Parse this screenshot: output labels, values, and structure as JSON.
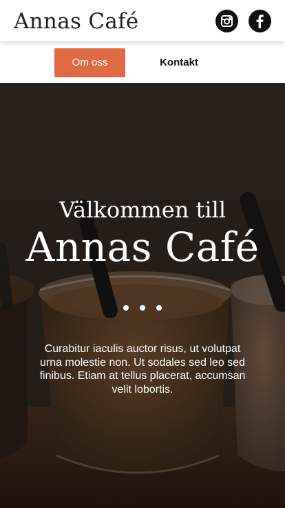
{
  "header": {
    "brand": "Annas Café",
    "social": [
      {
        "icon": "instagram-icon"
      },
      {
        "icon": "facebook-icon"
      }
    ]
  },
  "nav": {
    "items": [
      {
        "label": "Om oss",
        "active": true
      },
      {
        "label": "Kontakt",
        "active": false
      }
    ]
  },
  "hero": {
    "subtitle": "Välkommen till",
    "title": "Annas Café",
    "slide_count": 3,
    "description": "Curabitur iaculis auctor risus, ut volutpat urna molestie non. Ut sodales sed leo sed finibus. Etiam at tellus placerat, accumsan velit lobortis."
  },
  "colors": {
    "accent": "#e06a42",
    "header_bg": "#ffffff",
    "icon_bg": "#111111",
    "hero_text": "#ffffff"
  }
}
